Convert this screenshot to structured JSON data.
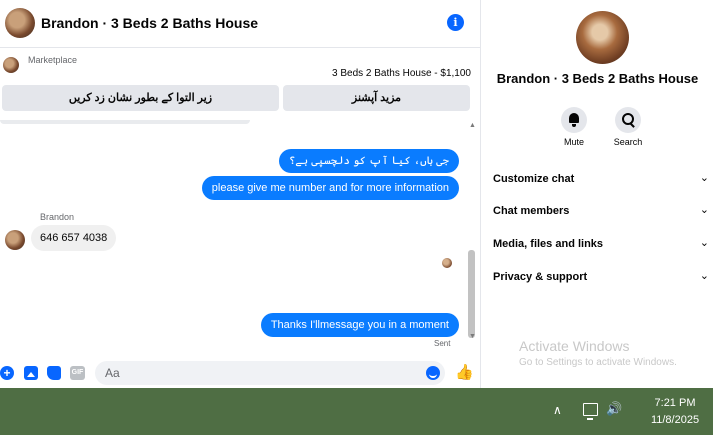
{
  "header": {
    "title": "Brandon · 3 Beds 2 Baths House"
  },
  "marketplace": {
    "label": "Marketplace",
    "listing": "3 Beds 2 Baths House - $1,100",
    "buttons": [
      "زیر التوا کے بطور نشان زد کریں",
      "مزید آپشنز"
    ]
  },
  "messages": [
    {
      "direction": "out",
      "text": "جی ہاں، کیا آپ کو دلچسپی ہے؟"
    },
    {
      "direction": "out",
      "text": "please give me number and for more information"
    },
    {
      "direction": "in",
      "sender": "Brandon",
      "text": "646 657 4038"
    },
    {
      "direction": "out",
      "text": "Thanks I'llmessage you in a moment"
    }
  ],
  "status": "Sent",
  "composer": {
    "placeholder": "Aa",
    "gif": "GIF"
  },
  "details": {
    "name": "Brandon · 3 Beds 2 Baths House",
    "actions": [
      {
        "label": "Mute",
        "icon": "bell-icon"
      },
      {
        "label": "Search",
        "icon": "search-icon"
      }
    ],
    "sections": [
      "Customize chat",
      "Chat members",
      "Media, files and links",
      "Privacy & support"
    ]
  },
  "watermark": {
    "title": "Activate Windows",
    "subtitle": "Go to Settings to activate Windows."
  },
  "taskbar": {
    "time": "7:21 PM",
    "date": "11/8/2025"
  },
  "colors": {
    "accent": "#0866ff",
    "bubble_out": "#0a7cff",
    "taskbar": "#4f6e44"
  }
}
